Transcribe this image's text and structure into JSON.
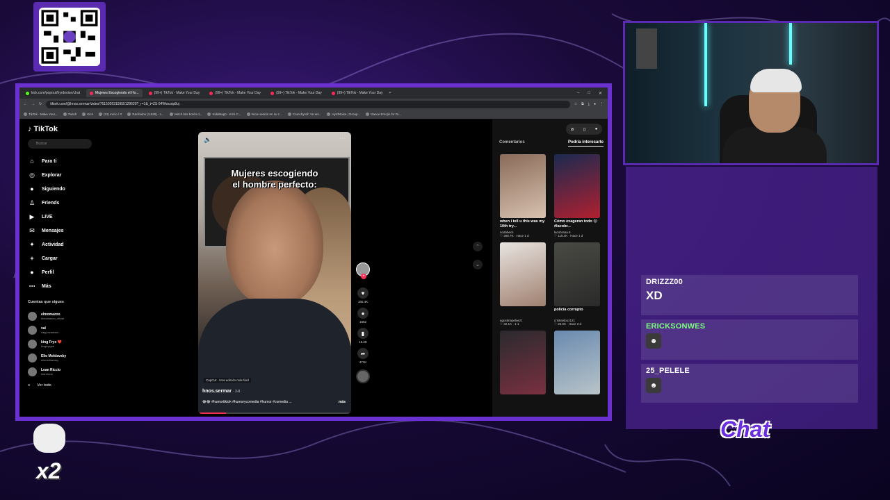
{
  "browser": {
    "tabs": [
      {
        "label": "kick.com/popout/hyrdnoise/chat",
        "active": false
      },
      {
        "label": "Mujeres Escogiendo el Ho...",
        "active": true
      },
      {
        "label": "(99+) TikTok - Make Your Day",
        "active": false
      },
      {
        "label": "(99+) TikTok - Make Your Day",
        "active": false
      },
      {
        "label": "(99+) TikTok - Make Your Day",
        "active": false
      },
      {
        "label": "(99+) TikTok - Make Your Day",
        "active": false
      }
    ],
    "url": "tiktok.com/@hnos.sermar/video/7615026315955129620?_r=1&_t=ZS-94Wwcotp8uj",
    "bookmarks": [
      "TikTok - Make Your...",
      "Twitch",
      "Kick",
      "(21) Inicio / X",
      "Recibidos (3,628) - c...",
      "twitch bits botón d...",
      "Kiddetapp - Kick C...",
      "Inicie sesión en su c...",
      "Crunchyroll: Ve ani...",
      "HyrdNoise | Group...",
      "Dance Emojis for Di..."
    ]
  },
  "tiktok": {
    "logo": "TikTok",
    "search_placeholder": "Buscar",
    "nav": [
      {
        "label": "Para ti",
        "icon": "⌂"
      },
      {
        "label": "Explorar",
        "icon": "◎"
      },
      {
        "label": "Siguiendo",
        "icon": "●"
      },
      {
        "label": "Friends",
        "icon": "♙"
      },
      {
        "label": "LIVE",
        "icon": "▶"
      },
      {
        "label": "Mensajes",
        "icon": "✉"
      },
      {
        "label": "Actividad",
        "icon": "✦"
      },
      {
        "label": "Cargar",
        "icon": "+"
      },
      {
        "label": "Perfil",
        "icon": "●"
      },
      {
        "label": "Más",
        "icon": "⋯"
      }
    ],
    "following_title": "Cuentas que sigues",
    "following": [
      {
        "name": "elmomazoo",
        "handle": "elmomazoo_oficial"
      },
      {
        "name": "val",
        "handle": "valgonzalesss"
      },
      {
        "name": "king Frys ❤️",
        "handle": "kingfrysjoe"
      },
      {
        "name": "Elio Moldavsky",
        "handle": "eiiomoldavsky"
      },
      {
        "name": "Lean Riccio",
        "handle": "leanriccio"
      }
    ],
    "see_all": "Ver todo",
    "video": {
      "caption_line1": "Mujeres escogiendo",
      "caption_line2": "el hombre perfecto:",
      "capcut": "CapCut · Una edición más fácil",
      "author": "hnos.sermar",
      "author_time": "· 3-8",
      "description": "😂😂 #humortiktok #humorycomedia #humor #comedia ...",
      "more": "más",
      "progress": 0.18
    },
    "actions": {
      "likes": "165.4K",
      "comments": "1662",
      "saves": "15.2K",
      "shares": "471K"
    },
    "right_tabs": [
      "Comentarios",
      "Podría interesarte"
    ],
    "cards": [
      {
        "title": "when i tell u this was my 10th try...",
        "author": "noahbeck",
        "meta": "♡ 358.7K · Hace 1 d",
        "c1": "#8a6a58",
        "c2": "#d8c2b0"
      },
      {
        "title": "Cómo exageran todo 😡 #lacobr...",
        "author": "lacobraaa.9",
        "meta": "♡ 115.4K · Hace 1 d",
        "c1": "#1a2a50",
        "c2": "#b02030"
      },
      {
        "title": "",
        "author": "agustinapelaezz",
        "meta": "♡ 32.1K · 1-1",
        "c1": "#e8e4e0",
        "c2": "#a08070"
      },
      {
        "title": "policía corrupto",
        "author": "cristianlpoz121",
        "meta": "♡ 26.6K · Hace 3 d",
        "c1": "#4a4a44",
        "c2": "#2a2a2a"
      },
      {
        "title": "",
        "author": "",
        "meta": "",
        "c1": "#2a2a2e",
        "c2": "#7a3040"
      },
      {
        "title": "",
        "author": "",
        "meta": "",
        "c1": "#6a8ab0",
        "c2": "#b8c4c8"
      }
    ]
  },
  "chat": {
    "messages": [
      {
        "user": "DRIZZZ00",
        "text": "XD",
        "color": "#ffffff"
      },
      {
        "user": "ERICKSONWES",
        "text": "",
        "color": "#7dff7d"
      },
      {
        "user": "25_PELELE",
        "text": "",
        "color": "#ffffff"
      }
    ],
    "label": "Chat"
  },
  "overlay": {
    "multiplier": "x2"
  }
}
